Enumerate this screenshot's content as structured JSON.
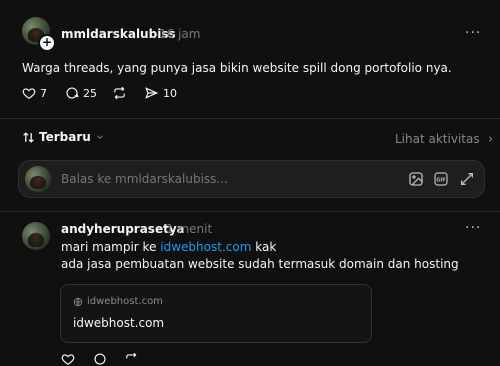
{
  "post": {
    "username": "mmldarskalubiss",
    "time": "16 jam",
    "text": "Warga threads, yang punya jasa bikin website spill dong portofolio nya.",
    "likes": "7",
    "replies": "25",
    "shares": "10",
    "more": "···"
  },
  "sort": {
    "label": "Terbaru",
    "activity_link": "Lihat aktivitas"
  },
  "reply_box": {
    "placeholder": "Balas ke mmldarskalubiss..."
  },
  "comment": {
    "username": "andyheruprasetya",
    "time": "1 menit",
    "line1_prefix": "mari mampir ke ",
    "line1_link": "idwebhost.com",
    "line1_suffix": " kak",
    "line2": "ada jasa pembuatan website sudah termasuk domain dan hosting",
    "more": "···",
    "card": {
      "domain": "idwebhost.com",
      "title": "idwebhost.com"
    }
  },
  "icons": [
    "heart-icon",
    "comment-icon",
    "repost-icon",
    "share-icon",
    "sort-icon",
    "chevron-down-icon",
    "chevron-right-icon",
    "image-icon",
    "gif-icon",
    "expand-icon",
    "globe-icon"
  ],
  "colors": {
    "background": "#101010",
    "link": "#1d9bf0",
    "muted": "#777777"
  }
}
